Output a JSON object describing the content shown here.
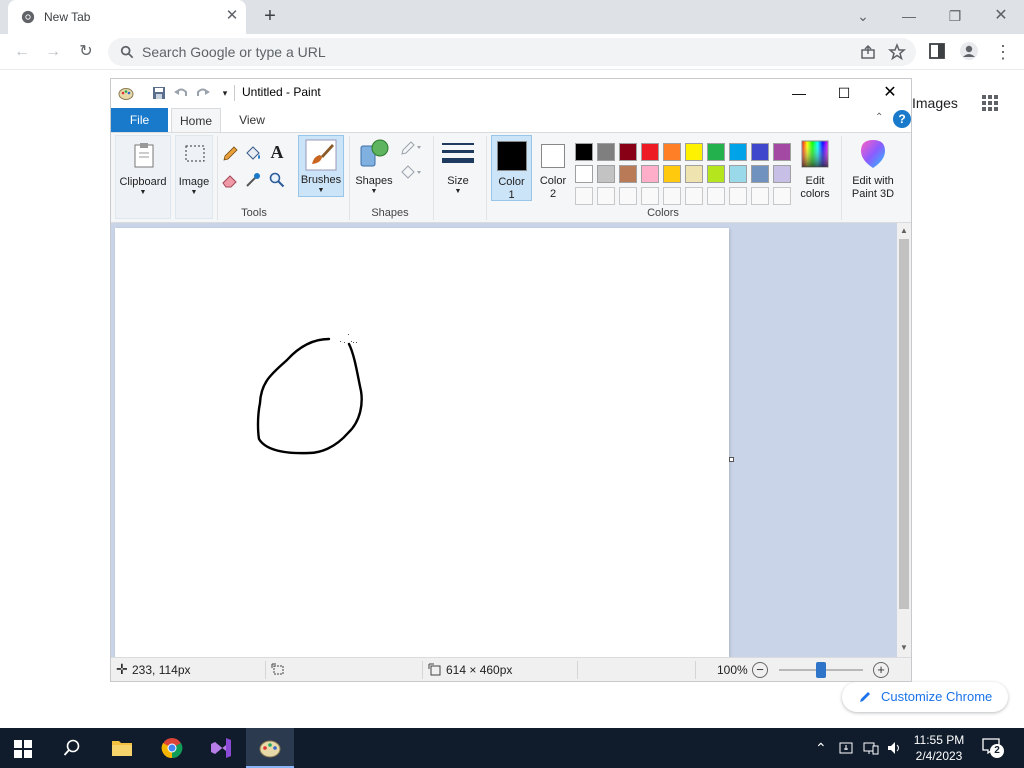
{
  "chrome": {
    "tab_title": "New Tab",
    "omnibox_placeholder": "Search Google or type a URL",
    "ntp_images_link": "Images",
    "customize_label": "Customize Chrome"
  },
  "paint": {
    "window_title": "Untitled - Paint",
    "tabs": {
      "file": "File",
      "home": "Home",
      "view": "View"
    },
    "ribbon": {
      "clipboard": "Clipboard",
      "image": "Image",
      "brushes": "Brushes",
      "shapes_btn": "Shapes",
      "size": "Size",
      "color1_a": "Color",
      "color1_b": "1",
      "color2_a": "Color",
      "color2_b": "2",
      "edit_colors_a": "Edit",
      "edit_colors_b": "colors",
      "paint3d_a": "Edit with",
      "paint3d_b": "Paint 3D",
      "group_tools": "Tools",
      "group_shapes": "Shapes",
      "group_colors": "Colors"
    },
    "palette_row1": [
      "#000000",
      "#7f7f7f",
      "#880015",
      "#ed1c24",
      "#ff7f27",
      "#fff200",
      "#22b14c",
      "#00a2e8",
      "#3f48cc",
      "#a349a4"
    ],
    "palette_row2": [
      "#ffffff",
      "#c3c3c3",
      "#b97a57",
      "#ffaec9",
      "#ffc90e",
      "#efe4b0",
      "#b5e61d",
      "#99d9ea",
      "#7092be",
      "#c8bfe7"
    ],
    "color1": "#000000",
    "color2": "#ffffff",
    "status": {
      "cursor_pos": "233, 114px",
      "image_size": "614 × 460px",
      "zoom": "100%"
    },
    "zoom_fraction": 0.5
  },
  "taskbar": {
    "time": "11:55 PM",
    "date": "2/4/2023",
    "notifications": "2"
  }
}
